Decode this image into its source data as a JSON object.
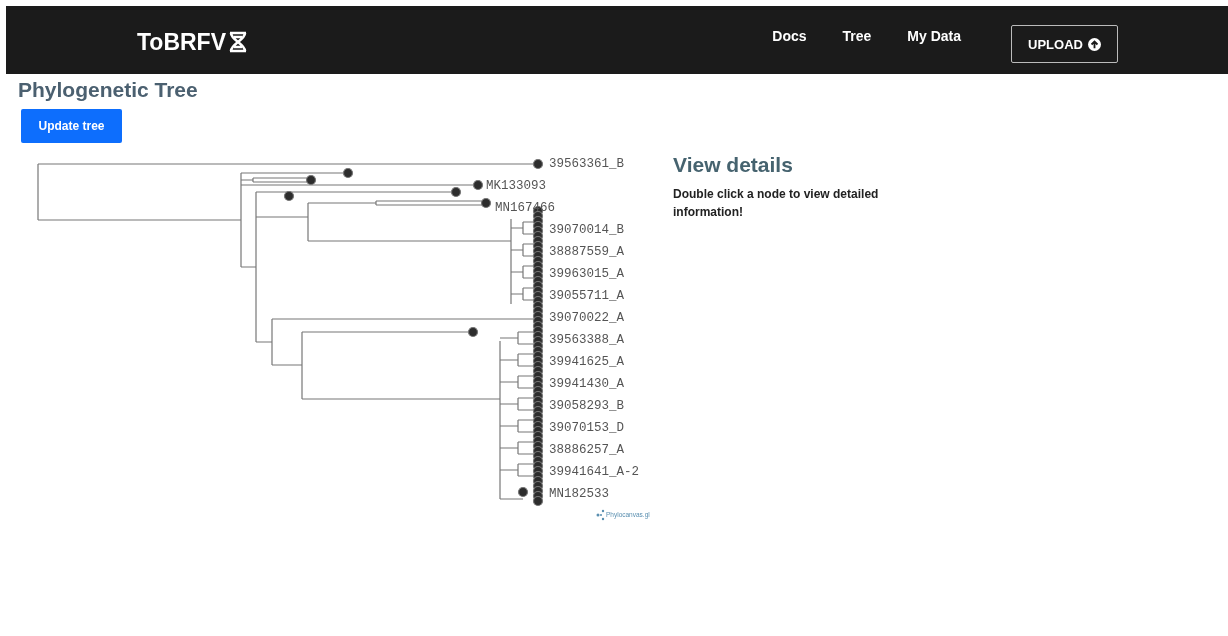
{
  "navbar": {
    "logo": "ToBRFV",
    "links": [
      "Docs",
      "Tree",
      "My Data"
    ],
    "upload_button": "UPLOAD"
  },
  "page": {
    "title": "Phylogenetic Tree",
    "update_button": "Update tree"
  },
  "tree": {
    "leaves": [
      "39563361_B",
      "MK133093",
      "MN167466",
      "39070014_B",
      "38887559_A",
      "39963015_A",
      "39055711_A",
      "39070022_A",
      "39563388_A",
      "39941625_A",
      "39941430_A",
      "39058293_B",
      "39070153_D",
      "38886257_A",
      "39941641_A-2",
      "MN182533"
    ],
    "credit": "Phylocanvas.gl"
  },
  "details": {
    "title": "View details",
    "text": "Double click a node to view detailed information!"
  }
}
